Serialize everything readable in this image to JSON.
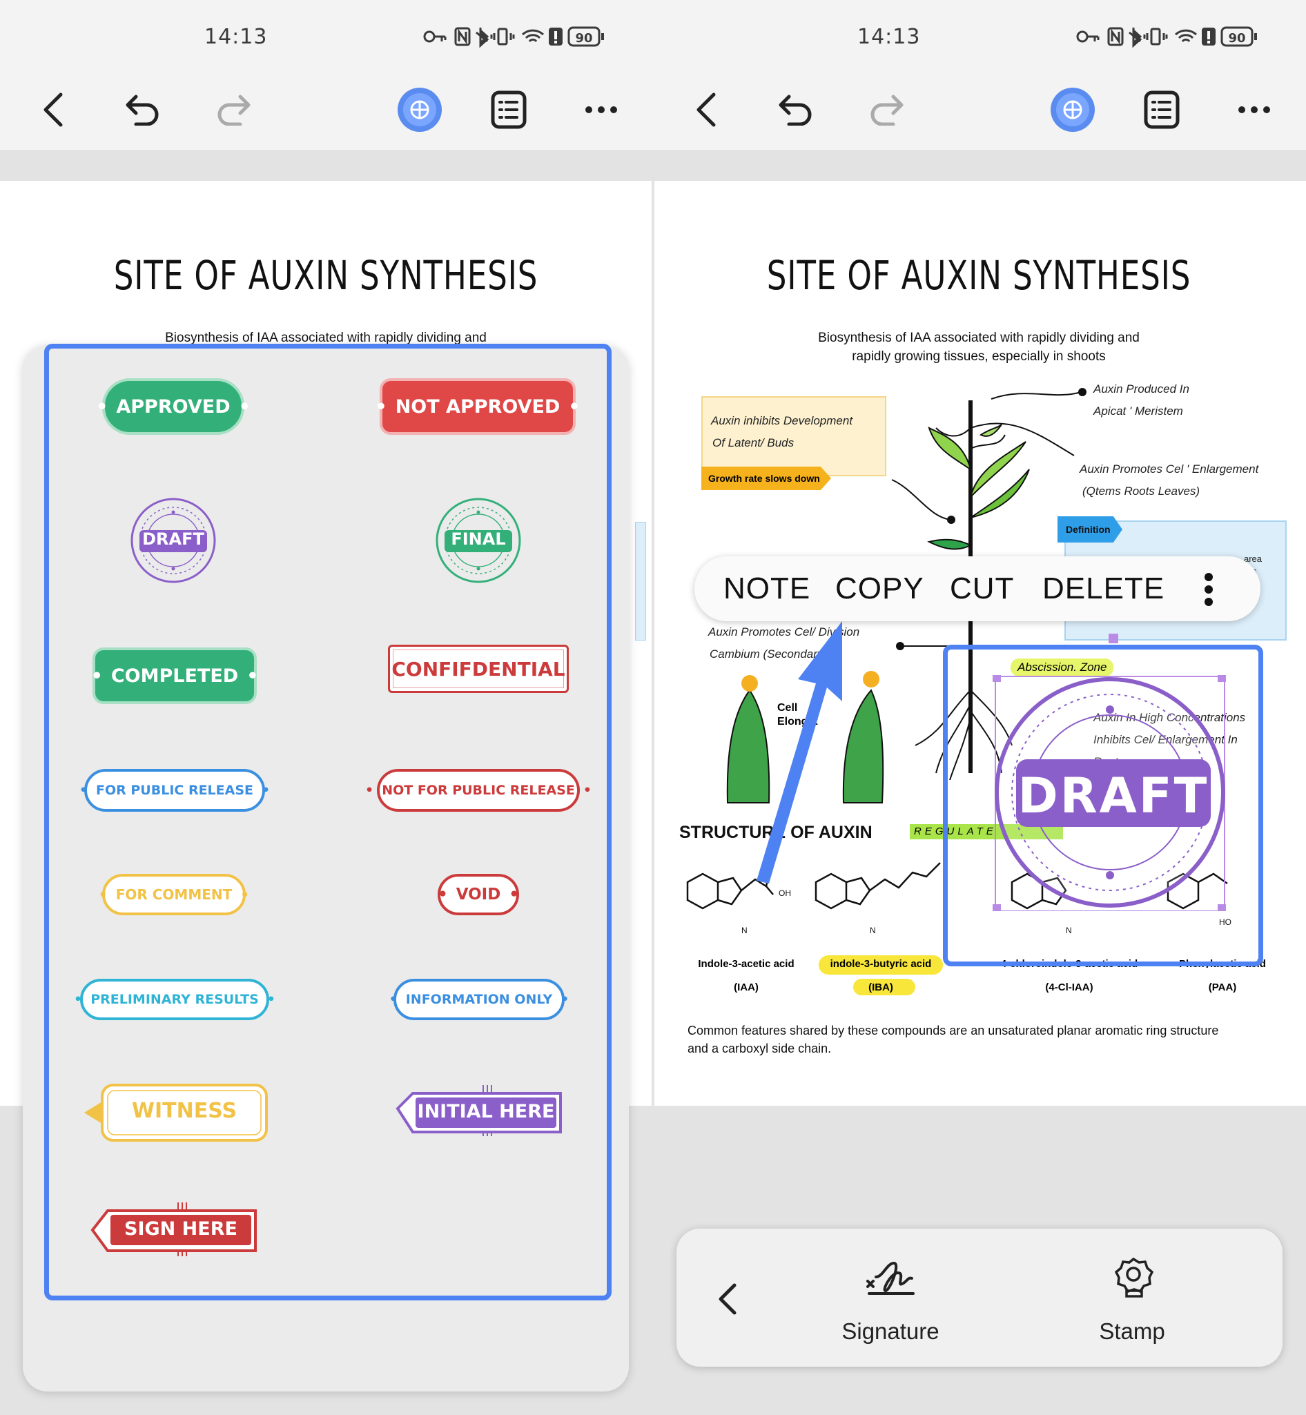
{
  "status_bar": {
    "time": "14:13",
    "battery": "90"
  },
  "doc": {
    "title": "SITE OF AUXIN SYNTHESIS",
    "subtitle_line1": "Biosynthesis of IAA associated with rapidly dividing and",
    "subtitle_line2": "rapidly growing tissues, especially in shoots"
  },
  "stamps": [
    {
      "label": "APPROVED",
      "color": "#33b07a"
    },
    {
      "label": "NOT APPROVED",
      "color": "#e04848"
    },
    {
      "label": "DRAFT",
      "color": "#8b5fc9"
    },
    {
      "label": "FINAL",
      "color": "#33b07a"
    },
    {
      "label": "COMPLETED",
      "color": "#33b07a"
    },
    {
      "label": "CONFIFDENTIAL",
      "color": "#cc3b3b"
    },
    {
      "label": "FOR PUBLIC RELEASE",
      "color": "#3b8fe0"
    },
    {
      "label": "NOT FOR PUBLIC RELEASE",
      "color": "#cc3b3b"
    },
    {
      "label": "FOR COMMENT",
      "color": "#f2c246"
    },
    {
      "label": "VOID",
      "color": "#cc3b3b"
    },
    {
      "label": "PRELIMINARY RESULTS",
      "color": "#2fb4d6"
    },
    {
      "label": "INFORMATION ONLY",
      "color": "#3b8fe0"
    },
    {
      "label": "WITNESS",
      "color": "#f2c246"
    },
    {
      "label": "INITIAL HERE",
      "color": "#8b5fc9"
    },
    {
      "label": "SIGN HERE",
      "color": "#cc3b3b"
    }
  ],
  "diagram": {
    "note_box_line1": "Auxin inhibits Development",
    "note_box_line2": "Of Latent/ Buds",
    "growth_tag": "Growth rate slows down",
    "produced_line1": "Auxin Produced In",
    "produced_line2": "Apicat ' Meristem",
    "promotes_line1": "Auxin Promotes Cel ' Enlargement",
    "promotes_line2": "(Qtems Roots Leaves)",
    "definition_tag": "Definition",
    "def_frag1": "area",
    "def_frag2": "s",
    "def_frag3": "s",
    "division_line1": "Auxin Promotes Cel/ Division",
    "division_line2": "Cambium (Secondary G",
    "abscission": "Abscission. Zone",
    "high_conc_line1": "Auxin In High Concentrations",
    "high_conc_line2": "Inhibits Cel/ Enlargement In",
    "high_conc_line3": "Roots",
    "cell_line1": "Cell",
    "cell_line2": "Elongat",
    "structure_heading": "STRUCTURE OF AUXIN",
    "regulate_tag": "REGULATE GROWTH",
    "stamp_text": "DRAFT",
    "compounds": [
      {
        "name": "Indole-3-acetic acid",
        "abbr": "(IAA)"
      },
      {
        "name": "indole-3-butyric acid",
        "abbr": "(IBA)"
      },
      {
        "name": "4-chloroindole-3-acetic acid",
        "abbr": "(4-Cl-IAA)"
      },
      {
        "name": "Phenylacetic acid",
        "abbr": "(PAA)"
      }
    ],
    "footer_line1": "Common features shared by these compounds are an unsaturated planar aromatic ring structure",
    "footer_line2": "and a carboxyl side chain."
  },
  "context_menu": {
    "items": [
      "NOTE",
      "COPY",
      "CUT",
      "DELETE"
    ]
  },
  "bottom_bar": {
    "signature_label": "Signature",
    "stamp_label": "Stamp"
  },
  "colors": {
    "accent": "#4e82f3",
    "stamp_purple": "#8b5fc9"
  }
}
